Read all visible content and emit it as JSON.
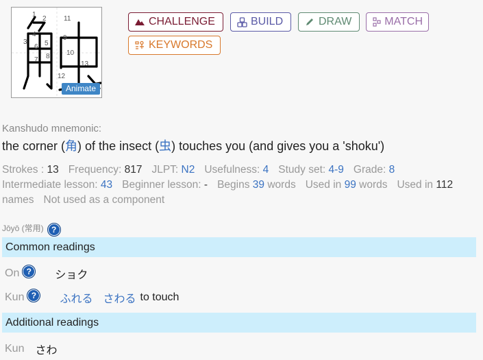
{
  "kanji": {
    "character": "触",
    "stroke_numbers": [
      "1",
      "2",
      "3",
      "4",
      "5",
      "6",
      "7",
      "8",
      "9",
      "10",
      "11",
      "12",
      "13"
    ],
    "animate_label": "Animate"
  },
  "toolbar": {
    "challenge": "CHALLENGE",
    "build": "BUILD",
    "draw": "DRAW",
    "match": "MATCH",
    "keywords": "KEYWORDS"
  },
  "mnemonic": {
    "label": "Kanshudo mnemonic:",
    "part1": "the corner (",
    "kanji1": "角",
    "part2": ") of the insect (",
    "kanji2": "虫",
    "part3": ") touches you (and gives you a 'shoku')"
  },
  "stats": {
    "strokes_label": "Strokes : ",
    "strokes": "13",
    "frequency_label": "Frequency: ",
    "frequency": "817",
    "jlpt_label": "JLPT: ",
    "jlpt": "N2",
    "usefulness_label": "Usefulness: ",
    "usefulness": "4",
    "studyset_label": "Study set: ",
    "studyset": "4-9",
    "grade_label": "Grade: ",
    "grade": "8",
    "intermediate_label": "Intermediate lesson: ",
    "intermediate": "43",
    "beginner_label": "Beginner lesson: ",
    "beginner": "-",
    "begins_label": "Begins ",
    "begins": "39",
    "begins_suffix": " words",
    "usedin_label": "Used in ",
    "usedin": "99",
    "usedin_suffix": " words",
    "usedin2_label": "Used in ",
    "usedin2": "112",
    "names": "names",
    "not_component": "Not used as a component"
  },
  "jouyou": {
    "label": "Jōyō (常用)"
  },
  "common_readings": {
    "title": "Common readings",
    "on_label": "On",
    "on_value": "ショク",
    "kun_label": "Kun",
    "kun_values": [
      "ふれる",
      "さわる"
    ],
    "kun_meaning": "to touch"
  },
  "additional_readings": {
    "title": "Additional readings",
    "kun_label": "Kun",
    "kun_value": "さわ"
  },
  "help_symbol": "?",
  "colors": {
    "challenge": "#7a1c33",
    "build": "#5a5aa6",
    "draw": "#5f8a72",
    "match": "#9a6ea8",
    "keywords": "#d8782b",
    "section_bg": "#cdeefc",
    "link": "#3b73c2"
  }
}
